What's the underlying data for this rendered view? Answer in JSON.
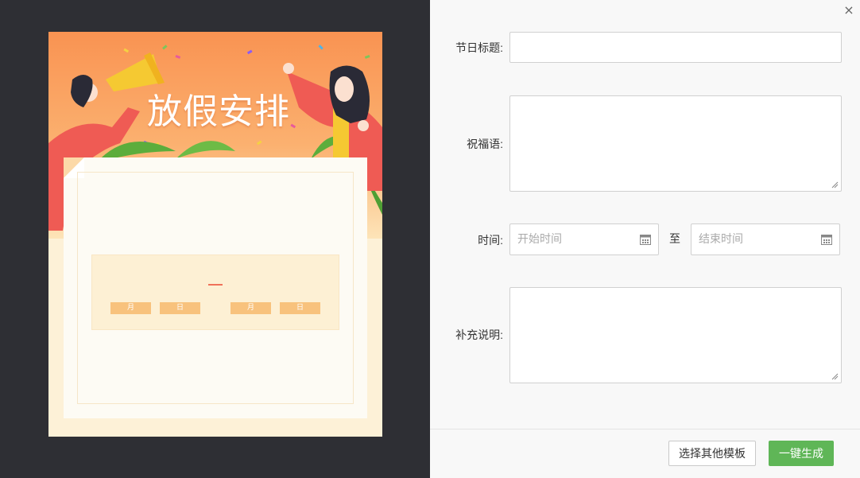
{
  "preview": {
    "poster_title": "放假安排",
    "date_chips": [
      "月",
      "日",
      "月",
      "日"
    ]
  },
  "form": {
    "close_glyph": "×",
    "title_label": "节日标题:",
    "title_value": "",
    "greeting_label": "祝福语:",
    "greeting_value": "",
    "time_label": "时间:",
    "start_placeholder": "开始时间",
    "range_separator": "至",
    "end_placeholder": "结束时间",
    "notes_label": "补充说明:",
    "notes_value": ""
  },
  "footer": {
    "other_template_button": "选择其他模板",
    "generate_button": "一键生成"
  },
  "colors": {
    "primary_button": "#5fb657",
    "poster_orange": "#f99352",
    "preview_bg": "#2e2f34"
  },
  "icons": [
    "close-icon",
    "calendar-icon",
    "calendar-icon",
    "resize-grip-icon",
    "resize-grip-icon"
  ]
}
